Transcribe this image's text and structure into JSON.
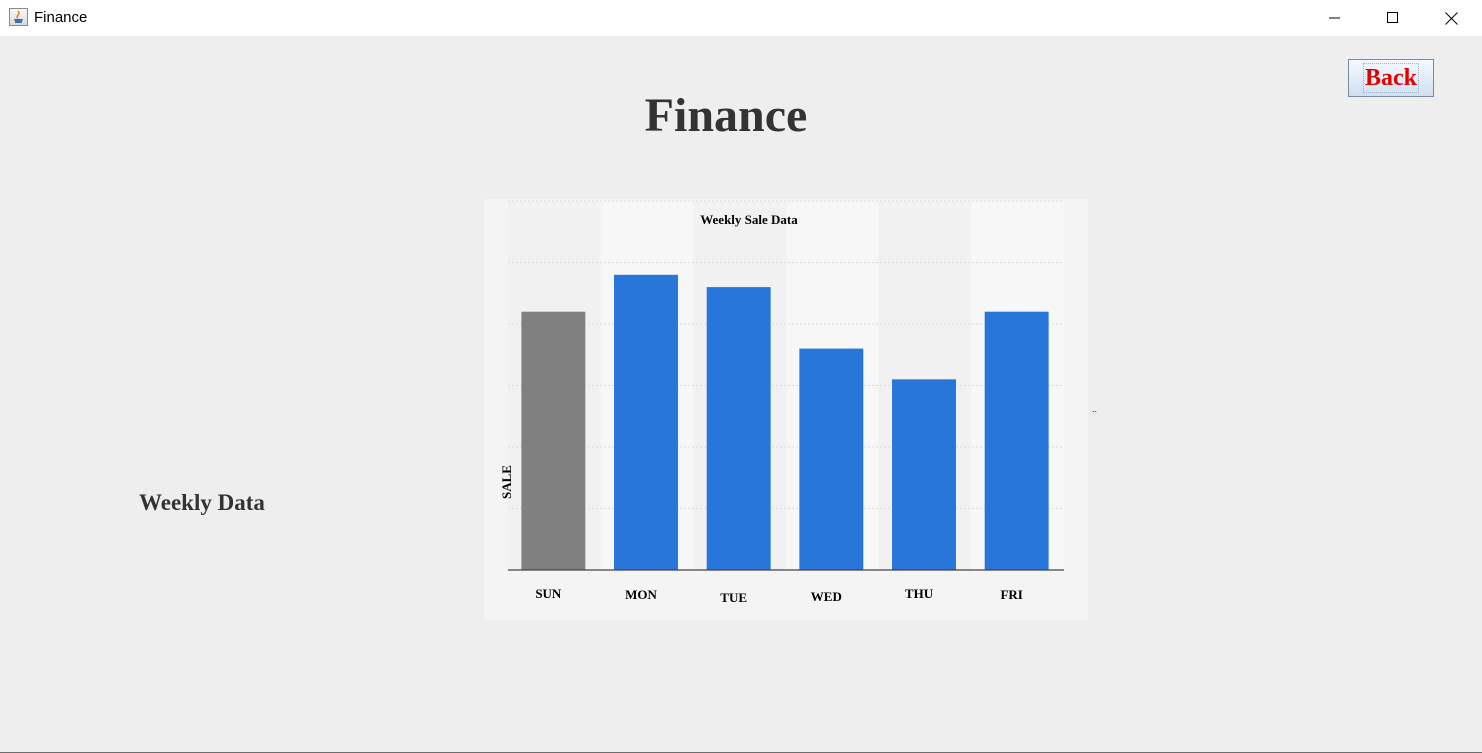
{
  "window": {
    "title": "Finance"
  },
  "header": {
    "title": "Finance",
    "back_label": "Back"
  },
  "side": {
    "label": "Weekly Data"
  },
  "side_mark": "..",
  "colors": {
    "bar": "#2876d9",
    "highlight_bar": "#808080",
    "back_text": "#e00000",
    "title_text": "#333333"
  },
  "chart_data": {
    "type": "bar",
    "title": "Weekly Sale Data",
    "ylabel": "SALE",
    "xlabel": "",
    "categories": [
      "SUN",
      "MON",
      "TUE",
      "WED",
      "THU",
      "FRI"
    ],
    "values": [
      42,
      48,
      46,
      36,
      31,
      42
    ],
    "ylim": [
      0,
      60
    ],
    "highlighted_category": "SUN",
    "grid": true,
    "legend": "none"
  }
}
